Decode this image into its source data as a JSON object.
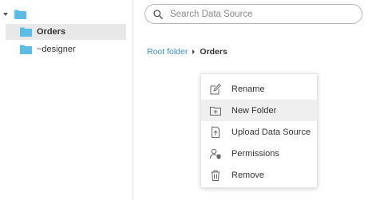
{
  "tree": {
    "items": [
      {
        "label": "Orders",
        "selected": true
      },
      {
        "label": "~designer",
        "selected": false
      }
    ]
  },
  "search": {
    "placeholder": "Search Data Source",
    "value": ""
  },
  "breadcrumb": {
    "root": "Root folder",
    "current": "Orders"
  },
  "context_menu": {
    "items": [
      {
        "label": "Rename",
        "icon": "rename-icon"
      },
      {
        "label": "New Folder",
        "icon": "new-folder-icon",
        "hovered": true
      },
      {
        "label": "Upload Data Source",
        "icon": "upload-data-source-icon"
      },
      {
        "label": "Permissions",
        "icon": "permissions-icon"
      },
      {
        "label": "Remove",
        "icon": "trash-icon"
      }
    ]
  },
  "colors": {
    "folder": "#5bbde6",
    "link": "#3a8fd0",
    "selection": "#e8e8e8",
    "menu_hover": "#efefef"
  }
}
